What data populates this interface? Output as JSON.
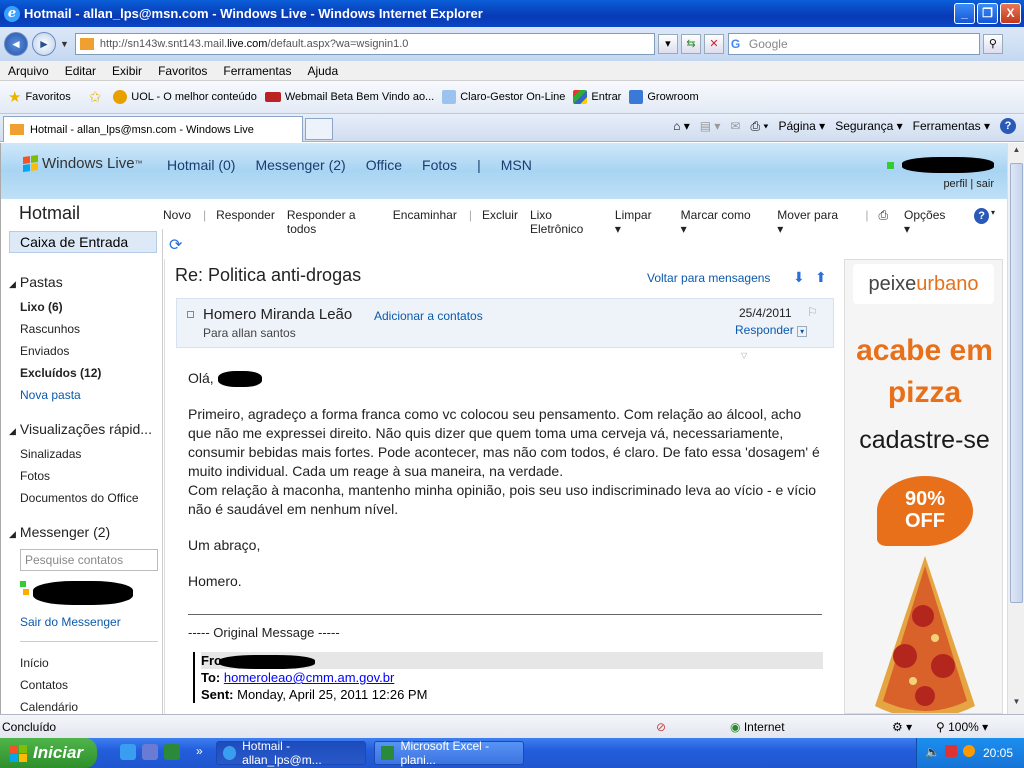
{
  "window": {
    "title": "Hotmail - allan_lps@msn.com - Windows Live - Windows Internet Explorer",
    "buttons": {
      "minimize": "_",
      "restore": "❐",
      "close": "X"
    }
  },
  "address": {
    "url_prefix": "http://sn143w.snt143.mail.",
    "url_domain": "live.com",
    "url_suffix": "/default.aspx?wa=wsignin1.0",
    "search_placeholder": "Google"
  },
  "menu": [
    "Arquivo",
    "Editar",
    "Exibir",
    "Favoritos",
    "Ferramentas",
    "Ajuda"
  ],
  "favorites": {
    "label": "Favoritos",
    "items": [
      "UOL - O melhor conteúdo",
      "Webmail Beta  Bem Vindo ao...",
      "Claro-Gestor On-Line",
      "Entrar",
      "Growroom"
    ]
  },
  "tab": {
    "title": "Hotmail - allan_lps@msn.com - Windows Live"
  },
  "commandbar": {
    "page": "Página",
    "security": "Segurança",
    "tools": "Ferramentas"
  },
  "wl": {
    "logo": "Windows Live",
    "logo_tm": "™",
    "nav": [
      "Hotmail (0)",
      "Messenger (2)",
      "Office",
      "Fotos",
      "|",
      "MSN"
    ],
    "profile": "perfil",
    "signout": "sair",
    "link_sep": "|"
  },
  "hotmail": {
    "title": "Hotmail",
    "toolbar": [
      "Novo",
      "Responder",
      "Responder a todos",
      "Encaminhar",
      "Excluir",
      "Lixo Eletrônico",
      "Limpar",
      "Marcar como",
      "Mover para",
      "Opções"
    ],
    "toolbar_sep": "|",
    "inbox": "Caixa de Entrada"
  },
  "leftnav": {
    "folders_title": "Pastas",
    "folders": [
      "Lixo (6)",
      "Rascunhos",
      "Enviados",
      "Excluídos (12)"
    ],
    "new_folder": "Nova pasta",
    "views_title": "Visualizações rápid...",
    "views": [
      "Sinalizadas",
      "Fotos",
      "Documentos do Office"
    ],
    "messenger_title": "Messenger (2)",
    "contact_search_placeholder": "Pesquise contatos",
    "sign_out_messenger": "Sair do Messenger",
    "bottom": [
      "Início",
      "Contatos",
      "Calendário"
    ]
  },
  "message": {
    "subject": "Re: Politica anti-drogas",
    "back_link": "Voltar para mensagens",
    "sender": "Homero Miranda Leão",
    "add_contact": "Adicionar a contatos",
    "to_line": "Para allan santos",
    "date": "25/4/2011",
    "reply": "Responder",
    "greeting": "Olá,",
    "paragraph1": "Primeiro, agradeço a forma franca como vc colocou seu pensamento. Com relação ao álcool, acho que não me expressei direito. Não quis dizer que quem toma uma cerveja vá, necessariamente, consumir bebidas mais fortes. Pode acontecer, mas não com todos, é claro. De fato essa 'dosagem' é muito individual. Cada um reage à sua maneira, na verdade.",
    "paragraph2": "Com relação à maconha, mantenho minha opinião, pois seu uso indiscriminado leva ao vício - e vício não é saudável em nenhum nível.",
    "closing": "Um abraço,",
    "signature": "Homero.",
    "original_header": "----- Original Message -----",
    "from_label": "From:",
    "to_label": "To:",
    "to_value": "homeroleao@cmm.am.gov.br",
    "sent_label": "Sent:",
    "sent_value": "Monday, April 25, 2011 12:26 PM"
  },
  "ad": {
    "brand_a": "peixe",
    "brand_b": "urbano",
    "line1": "acabe em",
    "line2": "pizza",
    "line3": "cadastre-se",
    "badge1": "90%",
    "badge2": "OFF"
  },
  "status": {
    "text": "Concluído",
    "zone": "Internet",
    "zoom": "100%"
  },
  "taskbar": {
    "start": "Iniciar",
    "items": [
      "Hotmail - allan_lps@m...",
      "Microsoft Excel - plani..."
    ],
    "overflow": "»",
    "time": "20:05"
  },
  "colors": {
    "accent": "#0b5aad",
    "orange": "#e8701a"
  }
}
